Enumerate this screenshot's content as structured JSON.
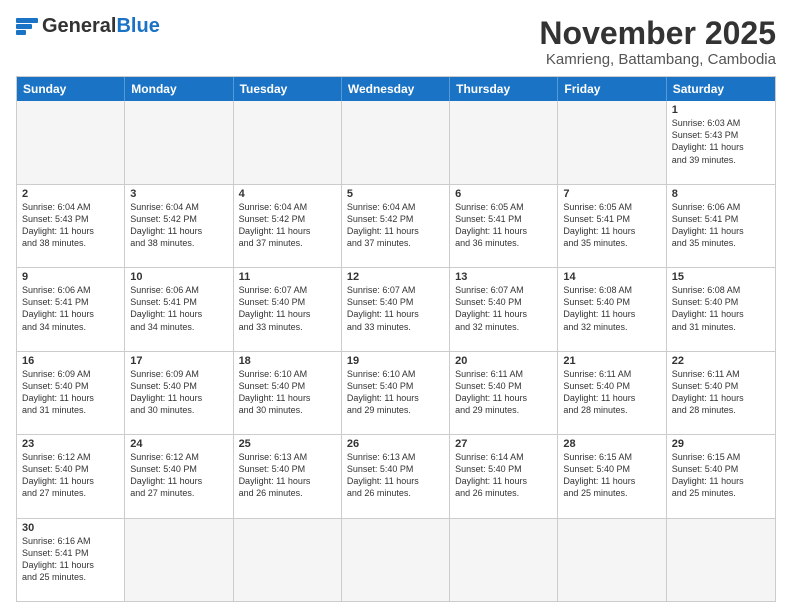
{
  "header": {
    "logo_general": "General",
    "logo_blue": "Blue",
    "month_title": "November 2025",
    "location": "Kamrieng, Battambang, Cambodia"
  },
  "days_of_week": [
    "Sunday",
    "Monday",
    "Tuesday",
    "Wednesday",
    "Thursday",
    "Friday",
    "Saturday"
  ],
  "weeks": [
    [
      {
        "day": "",
        "info": ""
      },
      {
        "day": "",
        "info": ""
      },
      {
        "day": "",
        "info": ""
      },
      {
        "day": "",
        "info": ""
      },
      {
        "day": "",
        "info": ""
      },
      {
        "day": "",
        "info": ""
      },
      {
        "day": "1",
        "info": "Sunrise: 6:03 AM\nSunset: 5:43 PM\nDaylight: 11 hours\nand 39 minutes."
      }
    ],
    [
      {
        "day": "2",
        "info": "Sunrise: 6:04 AM\nSunset: 5:43 PM\nDaylight: 11 hours\nand 38 minutes."
      },
      {
        "day": "3",
        "info": "Sunrise: 6:04 AM\nSunset: 5:42 PM\nDaylight: 11 hours\nand 38 minutes."
      },
      {
        "day": "4",
        "info": "Sunrise: 6:04 AM\nSunset: 5:42 PM\nDaylight: 11 hours\nand 37 minutes."
      },
      {
        "day": "5",
        "info": "Sunrise: 6:04 AM\nSunset: 5:42 PM\nDaylight: 11 hours\nand 37 minutes."
      },
      {
        "day": "6",
        "info": "Sunrise: 6:05 AM\nSunset: 5:41 PM\nDaylight: 11 hours\nand 36 minutes."
      },
      {
        "day": "7",
        "info": "Sunrise: 6:05 AM\nSunset: 5:41 PM\nDaylight: 11 hours\nand 35 minutes."
      },
      {
        "day": "8",
        "info": "Sunrise: 6:06 AM\nSunset: 5:41 PM\nDaylight: 11 hours\nand 35 minutes."
      }
    ],
    [
      {
        "day": "9",
        "info": "Sunrise: 6:06 AM\nSunset: 5:41 PM\nDaylight: 11 hours\nand 34 minutes."
      },
      {
        "day": "10",
        "info": "Sunrise: 6:06 AM\nSunset: 5:41 PM\nDaylight: 11 hours\nand 34 minutes."
      },
      {
        "day": "11",
        "info": "Sunrise: 6:07 AM\nSunset: 5:40 PM\nDaylight: 11 hours\nand 33 minutes."
      },
      {
        "day": "12",
        "info": "Sunrise: 6:07 AM\nSunset: 5:40 PM\nDaylight: 11 hours\nand 33 minutes."
      },
      {
        "day": "13",
        "info": "Sunrise: 6:07 AM\nSunset: 5:40 PM\nDaylight: 11 hours\nand 32 minutes."
      },
      {
        "day": "14",
        "info": "Sunrise: 6:08 AM\nSunset: 5:40 PM\nDaylight: 11 hours\nand 32 minutes."
      },
      {
        "day": "15",
        "info": "Sunrise: 6:08 AM\nSunset: 5:40 PM\nDaylight: 11 hours\nand 31 minutes."
      }
    ],
    [
      {
        "day": "16",
        "info": "Sunrise: 6:09 AM\nSunset: 5:40 PM\nDaylight: 11 hours\nand 31 minutes."
      },
      {
        "day": "17",
        "info": "Sunrise: 6:09 AM\nSunset: 5:40 PM\nDaylight: 11 hours\nand 30 minutes."
      },
      {
        "day": "18",
        "info": "Sunrise: 6:10 AM\nSunset: 5:40 PM\nDaylight: 11 hours\nand 30 minutes."
      },
      {
        "day": "19",
        "info": "Sunrise: 6:10 AM\nSunset: 5:40 PM\nDaylight: 11 hours\nand 29 minutes."
      },
      {
        "day": "20",
        "info": "Sunrise: 6:11 AM\nSunset: 5:40 PM\nDaylight: 11 hours\nand 29 minutes."
      },
      {
        "day": "21",
        "info": "Sunrise: 6:11 AM\nSunset: 5:40 PM\nDaylight: 11 hours\nand 28 minutes."
      },
      {
        "day": "22",
        "info": "Sunrise: 6:11 AM\nSunset: 5:40 PM\nDaylight: 11 hours\nand 28 minutes."
      }
    ],
    [
      {
        "day": "23",
        "info": "Sunrise: 6:12 AM\nSunset: 5:40 PM\nDaylight: 11 hours\nand 27 minutes."
      },
      {
        "day": "24",
        "info": "Sunrise: 6:12 AM\nSunset: 5:40 PM\nDaylight: 11 hours\nand 27 minutes."
      },
      {
        "day": "25",
        "info": "Sunrise: 6:13 AM\nSunset: 5:40 PM\nDaylight: 11 hours\nand 26 minutes."
      },
      {
        "day": "26",
        "info": "Sunrise: 6:13 AM\nSunset: 5:40 PM\nDaylight: 11 hours\nand 26 minutes."
      },
      {
        "day": "27",
        "info": "Sunrise: 6:14 AM\nSunset: 5:40 PM\nDaylight: 11 hours\nand 26 minutes."
      },
      {
        "day": "28",
        "info": "Sunrise: 6:15 AM\nSunset: 5:40 PM\nDaylight: 11 hours\nand 25 minutes."
      },
      {
        "day": "29",
        "info": "Sunrise: 6:15 AM\nSunset: 5:40 PM\nDaylight: 11 hours\nand 25 minutes."
      }
    ],
    [
      {
        "day": "30",
        "info": "Sunrise: 6:16 AM\nSunset: 5:41 PM\nDaylight: 11 hours\nand 25 minutes."
      },
      {
        "day": "",
        "info": ""
      },
      {
        "day": "",
        "info": ""
      },
      {
        "day": "",
        "info": ""
      },
      {
        "day": "",
        "info": ""
      },
      {
        "day": "",
        "info": ""
      },
      {
        "day": "",
        "info": ""
      }
    ]
  ]
}
